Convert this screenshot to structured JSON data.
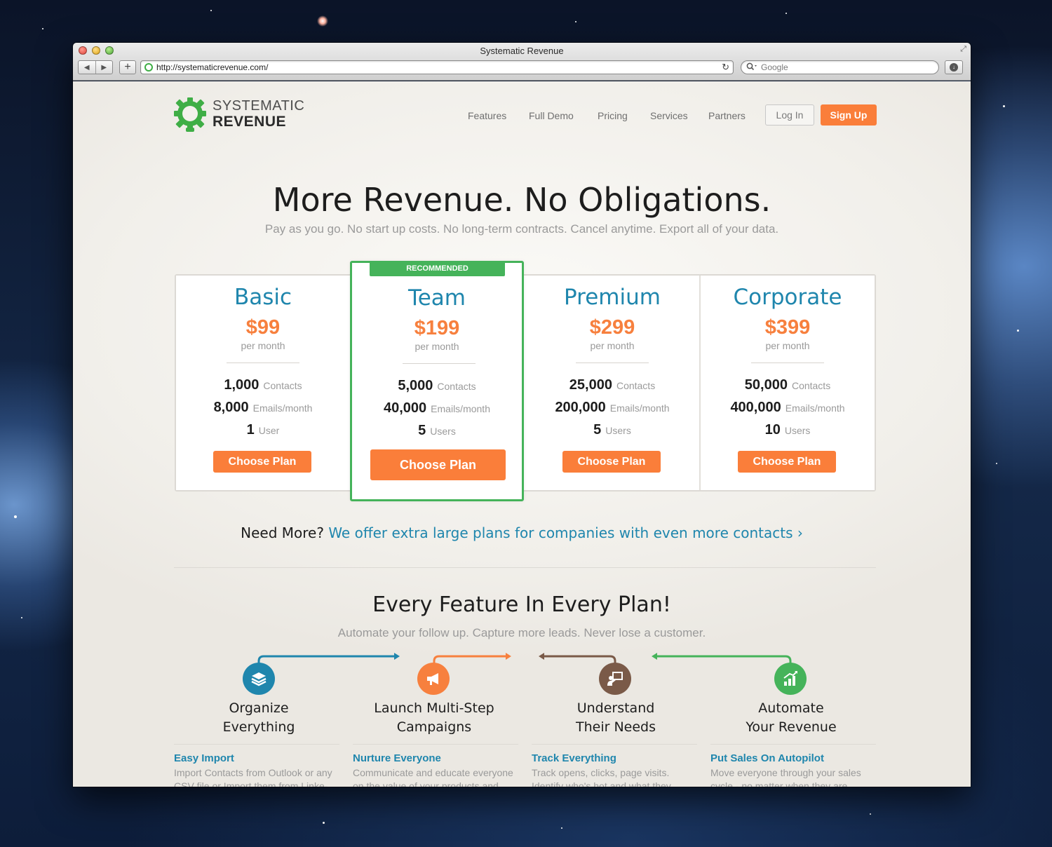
{
  "window": {
    "title": "Systematic Revenue"
  },
  "toolbar": {
    "url": "http://systematicrevenue.com/",
    "search_placeholder": "Google",
    "back_glyph": "◀",
    "forward_glyph": "▶",
    "new_tab_glyph": "+",
    "reload_glyph": "↻"
  },
  "brand": {
    "line1": "SYSTEMATIC",
    "line2": "REVENUE",
    "color": "#3fae46"
  },
  "nav": {
    "items": [
      "Features",
      "Full Demo",
      "Pricing",
      "Services",
      "Partners"
    ],
    "login": "Log In",
    "signup": "Sign Up"
  },
  "hero": {
    "title": "More Revenue. No Obligations.",
    "subtitle": "Pay as you go. No start up costs. No long-term contracts. Cancel anytime. Export all of your data."
  },
  "plans": [
    {
      "name": "Basic",
      "price": "$99",
      "period": "per month",
      "contacts": "1,000",
      "contacts_label": "Contacts",
      "emails": "8,000",
      "emails_label": "Emails/month",
      "users": "1",
      "users_label": "User",
      "cta": "Choose Plan",
      "badge": ""
    },
    {
      "name": "Team",
      "price": "$199",
      "period": "per month",
      "contacts": "5,000",
      "contacts_label": "Contacts",
      "emails": "40,000",
      "emails_label": "Emails/month",
      "users": "5",
      "users_label": "Users",
      "cta": "Choose Plan",
      "badge": "RECOMMENDED"
    },
    {
      "name": "Premium",
      "price": "$299",
      "period": "per month",
      "contacts": "25,000",
      "contacts_label": "Contacts",
      "emails": "200,000",
      "emails_label": "Emails/month",
      "users": "5",
      "users_label": "Users",
      "cta": "Choose Plan",
      "badge": ""
    },
    {
      "name": "Corporate",
      "price": "$399",
      "period": "per month",
      "contacts": "50,000",
      "contacts_label": "Contacts",
      "emails": "400,000",
      "emails_label": "Emails/month",
      "users": "10",
      "users_label": "Users",
      "cta": "Choose Plan",
      "badge": ""
    }
  ],
  "need_more": {
    "lead": "Need More?",
    "link": "We offer extra large plans for companies with even more contacts ›"
  },
  "features": {
    "title": "Every Feature In Every Plan!",
    "subtitle": "Automate your follow up. Capture more leads. Never lose a customer.",
    "items": [
      {
        "heading_1": "Organize",
        "heading_2": "Everything",
        "icon": "layers-icon",
        "color": "#1f86ad",
        "sub": "Easy Import",
        "desc": "Import Contacts from Outlook or any CSV file or Import them from Linke-"
      },
      {
        "heading_1": "Launch Multi-Step",
        "heading_2": "Campaigns",
        "icon": "megaphone-icon",
        "color": "#f7803e",
        "sub": "Nurture Everyone",
        "desc": "Communicate and educate everyone on the value of your products and"
      },
      {
        "heading_1": "Understand",
        "heading_2": "Their Needs",
        "icon": "presenter-icon",
        "color": "#7a5a48",
        "sub": "Track Everything",
        "desc": "Track opens, clicks, page visits. Identify who's hot and what they"
      },
      {
        "heading_1": "Automate",
        "heading_2": "Your Revenue",
        "icon": "growth-chart-icon",
        "color": "#45b35a",
        "sub": "Put Sales On Autopilot",
        "desc": "Move everyone through your sales cycle - no matter when they are"
      }
    ]
  }
}
